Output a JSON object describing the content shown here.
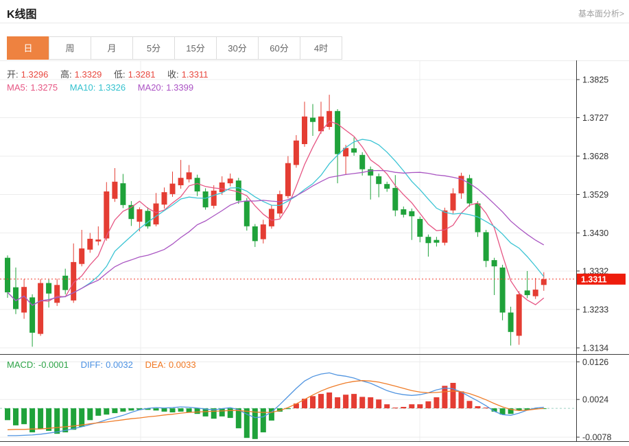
{
  "header": {
    "title": "K线图",
    "link_label": "基本面分析>"
  },
  "tabs": {
    "items": [
      "日",
      "周",
      "月",
      "5分",
      "15分",
      "30分",
      "60分",
      "4时"
    ],
    "active_index": 0
  },
  "ohlc_legend": {
    "open_label": "开:",
    "open_value": "1.3296",
    "high_label": "高:",
    "high_value": "1.3329",
    "low_label": "低:",
    "low_value": "1.3281",
    "close_label": "收:",
    "close_value": "1.3311"
  },
  "ma_legend": {
    "ma5_label": "MA5:",
    "ma5_value": "1.3275",
    "ma10_label": "MA10:",
    "ma10_value": "1.3326",
    "ma20_label": "MA20:",
    "ma20_value": "1.3399"
  },
  "macd_legend": {
    "macd_label": "MACD:",
    "macd_value": "-0.0001",
    "diff_label": "DIFF:",
    "diff_value": "0.0032",
    "dea_label": "DEA:",
    "dea_value": "0.0033"
  },
  "chart_data": {
    "type": "candlestick",
    "title": "K线图",
    "interval": "日",
    "grid": true,
    "legend_position": "top-left",
    "price_axis": {
      "ticks": [
        "1.3825",
        "1.3727",
        "1.3628",
        "1.3529",
        "1.3430",
        "1.3332",
        "1.3233",
        "1.3134"
      ],
      "tick_values": [
        1.3825,
        1.3727,
        1.3628,
        1.3529,
        1.343,
        1.3332,
        1.3233,
        1.3134
      ],
      "ylim": [
        1.3134,
        1.3825
      ],
      "last_price": "1.3311",
      "last_price_value": 1.3311
    },
    "macd_axis": {
      "ticks": [
        "0.0126",
        "0.0024",
        "-0.0078"
      ],
      "tick_values": [
        0.0126,
        0.0024,
        -0.0078
      ],
      "ylim": [
        -0.0089,
        0.0147
      ]
    },
    "candles_format": [
      "open",
      "close",
      "low",
      "high"
    ],
    "candles": [
      [
        1.3366,
        1.3277,
        1.3263,
        1.3372
      ],
      [
        1.329,
        1.3234,
        1.3221,
        1.3341
      ],
      [
        1.3225,
        1.3291,
        1.3209,
        1.3311
      ],
      [
        1.3264,
        1.3173,
        1.3137,
        1.3272
      ],
      [
        1.317,
        1.3301,
        1.3165,
        1.3311
      ],
      [
        1.3301,
        1.3274,
        1.3238,
        1.331
      ],
      [
        1.325,
        1.3296,
        1.3242,
        1.3312
      ],
      [
        1.332,
        1.3283,
        1.3272,
        1.3338
      ],
      [
        1.3256,
        1.3355,
        1.325,
        1.3403
      ],
      [
        1.335,
        1.339,
        1.3344,
        1.3438
      ],
      [
        1.3387,
        1.3415,
        1.3379,
        1.343
      ],
      [
        1.3408,
        1.3413,
        1.3398,
        1.3447
      ],
      [
        1.3416,
        1.3537,
        1.341,
        1.3561
      ],
      [
        1.3518,
        1.3562,
        1.351,
        1.3597
      ],
      [
        1.3558,
        1.3502,
        1.3494,
        1.3582
      ],
      [
        1.3502,
        1.3466,
        1.3448,
        1.3512
      ],
      [
        1.3459,
        1.3491,
        1.3434,
        1.3496
      ],
      [
        1.3487,
        1.3447,
        1.3441,
        1.3496
      ],
      [
        1.3452,
        1.3506,
        1.3447,
        1.3533
      ],
      [
        1.3503,
        1.3535,
        1.3493,
        1.3547
      ],
      [
        1.353,
        1.3557,
        1.3523,
        1.3588
      ],
      [
        1.3553,
        1.3572,
        1.3544,
        1.3618
      ],
      [
        1.3568,
        1.3586,
        1.356,
        1.3605
      ],
      [
        1.3572,
        1.3537,
        1.3525,
        1.358
      ],
      [
        1.3537,
        1.3496,
        1.349,
        1.3545
      ],
      [
        1.35,
        1.3539,
        1.3493,
        1.3553
      ],
      [
        1.3535,
        1.356,
        1.3528,
        1.3576
      ],
      [
        1.3558,
        1.357,
        1.355,
        1.3583
      ],
      [
        1.3565,
        1.3513,
        1.3505,
        1.3572
      ],
      [
        1.3513,
        1.3447,
        1.3436,
        1.352
      ],
      [
        1.3447,
        1.3409,
        1.3394,
        1.3453
      ],
      [
        1.3414,
        1.3452,
        1.3403,
        1.3464
      ],
      [
        1.3447,
        1.3492,
        1.3441,
        1.3502
      ],
      [
        1.348,
        1.353,
        1.347,
        1.3539
      ],
      [
        1.3525,
        1.361,
        1.3519,
        1.3628
      ],
      [
        1.3605,
        1.3668,
        1.3598,
        1.3682
      ],
      [
        1.3659,
        1.373,
        1.3652,
        1.3768
      ],
      [
        1.3727,
        1.3716,
        1.368,
        1.3762
      ],
      [
        1.3692,
        1.373,
        1.3686,
        1.3768
      ],
      [
        1.3703,
        1.3744,
        1.3696,
        1.3786
      ],
      [
        1.3744,
        1.3633,
        1.3558,
        1.3749
      ],
      [
        1.3627,
        1.3649,
        1.358,
        1.3657
      ],
      [
        1.3648,
        1.3637,
        1.3629,
        1.3676
      ],
      [
        1.3631,
        1.3594,
        1.3578,
        1.3638
      ],
      [
        1.3594,
        1.3578,
        1.3516,
        1.3601
      ],
      [
        1.3576,
        1.3556,
        1.3522,
        1.3583
      ],
      [
        1.3556,
        1.3544,
        1.3536,
        1.3562
      ],
      [
        1.3546,
        1.3488,
        1.3473,
        1.3579
      ],
      [
        1.3491,
        1.3477,
        1.347,
        1.3498
      ],
      [
        1.3486,
        1.3473,
        1.3412,
        1.3493
      ],
      [
        1.3466,
        1.342,
        1.3406,
        1.3472
      ],
      [
        1.342,
        1.3404,
        1.3369,
        1.3426
      ],
      [
        1.3412,
        1.3405,
        1.3395,
        1.342
      ],
      [
        1.3405,
        1.3488,
        1.3398,
        1.3495
      ],
      [
        1.3488,
        1.3532,
        1.348,
        1.3545
      ],
      [
        1.3532,
        1.3577,
        1.3518,
        1.3585
      ],
      [
        1.3571,
        1.3506,
        1.3498,
        1.358
      ],
      [
        1.3506,
        1.3432,
        1.342,
        1.3512
      ],
      [
        1.3432,
        1.3358,
        1.3342,
        1.3438
      ],
      [
        1.336,
        1.3344,
        1.327,
        1.3366
      ],
      [
        1.3341,
        1.3225,
        1.3205,
        1.3348
      ],
      [
        1.3225,
        1.3175,
        1.314,
        1.324
      ],
      [
        1.3165,
        1.3272,
        1.3142,
        1.328
      ],
      [
        1.3282,
        1.327,
        1.3262,
        1.3332
      ],
      [
        1.3267,
        1.3284,
        1.326,
        1.3314
      ],
      [
        1.3296,
        1.3311,
        1.3281,
        1.3329
      ]
    ],
    "ma_periods": [
      5,
      10,
      20
    ],
    "macd": {
      "hist": [
        -0.0032,
        -0.0046,
        -0.0043,
        -0.0065,
        -0.0056,
        -0.0061,
        -0.0069,
        -0.0065,
        -0.0058,
        -0.005,
        -0.0032,
        -0.002,
        -0.0017,
        -0.0013,
        -0.0009,
        -0.0006,
        -0.0004,
        -0.0004,
        -0.0006,
        -0.0009,
        -0.0011,
        -0.0009,
        -0.0011,
        -0.0015,
        -0.0022,
        -0.0028,
        -0.0022,
        -0.0026,
        -0.0054,
        -0.008,
        -0.0083,
        -0.0065,
        -0.0033,
        -0.0009,
        -0.0002,
        0.0013,
        0.0026,
        0.0033,
        0.0039,
        0.0043,
        0.003,
        0.0037,
        0.0039,
        0.0031,
        0.003,
        0.0024,
        0.0011,
        0.0002,
        0.0004,
        0.0011,
        0.0011,
        0.0019,
        0.003,
        0.0061,
        0.0069,
        0.0046,
        0.002,
        0.0006,
        0.0002,
        -0.0009,
        -0.0017,
        -0.0015,
        -0.0006,
        -0.0004,
        -0.0001,
        -0.0001
      ],
      "diff": [
        -0.0074,
        -0.0074,
        -0.0073,
        -0.0072,
        -0.007,
        -0.0067,
        -0.0064,
        -0.006,
        -0.0055,
        -0.005,
        -0.0044,
        -0.0038,
        -0.0031,
        -0.0025,
        -0.0019,
        -0.0011,
        -0.0004,
        0.0,
        0.0002,
        0.0001,
        0.0002,
        0.0004,
        0.0003,
        0.0001,
        -0.0002,
        -0.0004,
        -0.0001,
        0.0002,
        -0.0004,
        -0.0016,
        -0.0025,
        -0.0023,
        -0.001,
        0.001,
        0.0032,
        0.0054,
        0.0074,
        0.0086,
        0.0093,
        0.0096,
        0.009,
        0.0087,
        0.0082,
        0.0074,
        0.0068,
        0.0058,
        0.0048,
        0.0041,
        0.0037,
        0.0035,
        0.0037,
        0.0042,
        0.005,
        0.0055,
        0.0053,
        0.0044,
        0.0032,
        0.002,
        0.0007,
        -0.0008,
        -0.0017,
        -0.0019,
        -0.0013,
        -0.0005,
        0.0001,
        0.0003
      ],
      "dea": [
        -0.0058,
        -0.0057,
        -0.0057,
        -0.0056,
        -0.0056,
        -0.0054,
        -0.0052,
        -0.005,
        -0.0048,
        -0.0045,
        -0.0042,
        -0.0039,
        -0.0037,
        -0.0034,
        -0.0031,
        -0.0028,
        -0.0026,
        -0.0023,
        -0.0021,
        -0.0018,
        -0.0016,
        -0.0013,
        -0.0011,
        -0.001,
        -0.0009,
        -0.0008,
        -0.0007,
        -0.0006,
        -0.0006,
        -0.0008,
        -0.001,
        -0.0011,
        -0.0011,
        -0.0006,
        0.0002,
        0.0012,
        0.0024,
        0.0036,
        0.0047,
        0.0056,
        0.0063,
        0.0069,
        0.0073,
        0.0075,
        0.0074,
        0.0071,
        0.0066,
        0.006,
        0.0054,
        0.0048,
        0.0044,
        0.0042,
        0.0043,
        0.0045,
        0.0047,
        0.0045,
        0.004,
        0.0032,
        0.0023,
        0.0013,
        0.0004,
        -0.0003,
        -0.0006,
        -0.0005,
        -0.0002,
        0.0
      ]
    },
    "colors": {
      "up": "#e43d33",
      "down": "#1fa23a",
      "ma5": "#e65583",
      "ma10": "#3bc4d4",
      "ma20": "#a955c2",
      "diff": "#5094e0",
      "dea": "#ef7c28",
      "grid": "#ececec",
      "axis": "#3a3a3a",
      "label": "#333333",
      "price_line": "#f23b2f",
      "price_tag_bg": "#ee1c0c",
      "zero_dash": "#9ccfc4",
      "accent_tab": "#ee8240"
    }
  }
}
